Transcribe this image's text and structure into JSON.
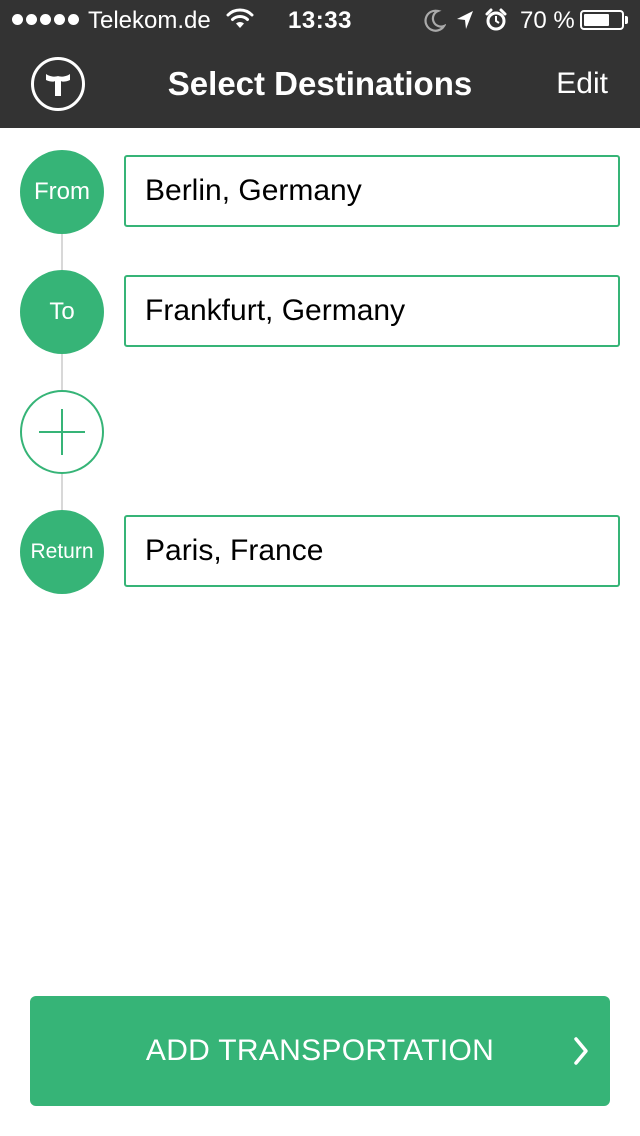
{
  "status_bar": {
    "carrier": "Telekom.de",
    "time": "13:33",
    "battery_percent": "70 %",
    "battery_level": 0.7,
    "icons": [
      "signal-dots-icon",
      "wifi-icon",
      "moon-icon",
      "location-arrow-icon",
      "alarm-icon",
      "battery-icon"
    ]
  },
  "nav": {
    "title": "Select Destinations",
    "edit_label": "Edit",
    "logo_icon": "t-logo-icon"
  },
  "route": {
    "stops": [
      {
        "label": "From",
        "value": "Berlin, Germany"
      },
      {
        "label": "To",
        "value": "Frankfurt, Germany"
      },
      {
        "label": "Return",
        "value": "Paris, France"
      }
    ],
    "add_stop_icon": "plus-icon"
  },
  "cta": {
    "label": "ADD TRANSPORTATION",
    "icon": "chevron-right-icon"
  },
  "colors": {
    "accent": "#36b477",
    "header_bg": "#333333",
    "connector": "#d8d8d8"
  }
}
